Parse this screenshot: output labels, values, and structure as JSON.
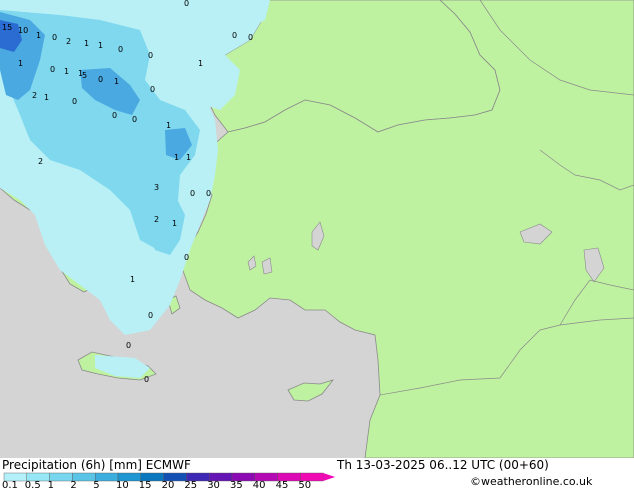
{
  "title": "Precipitation (6h) [mm] ECMWF",
  "valid_time": "Th 13-03-2025 06..12 UTC (00+60)",
  "credit": "©weatheronline.co.uk",
  "colors": {
    "sea": "#d4d4d4",
    "land": "#bff2a0",
    "border": "#8a8a8a",
    "precip_light": "#b8f0f6",
    "precip_mid": "#7fd8ee",
    "precip_heavy": "#4aa9e0",
    "precip_max": "#2a6cd2"
  },
  "legend": {
    "ticks": [
      "0.1",
      "0.5",
      "1",
      "2",
      "5",
      "10",
      "15",
      "20",
      "25",
      "30",
      "35",
      "40",
      "45",
      "50"
    ],
    "colors": [
      "#b4f0fa",
      "#96e6f5",
      "#78d7ee",
      "#5ac4e6",
      "#3caede",
      "#1e96d2",
      "#0a78be",
      "#1450b4",
      "#3c28b4",
      "#6414b4",
      "#8c0ab4",
      "#b40ab4",
      "#dc0ab4",
      "#f00ab4"
    ]
  },
  "map_values": [
    {
      "v": "15"
    },
    {
      "v": "10"
    },
    {
      "v": "1"
    },
    {
      "v": "0"
    },
    {
      "v": "2"
    },
    {
      "v": "1"
    },
    {
      "v": "1"
    },
    {
      "v": "0"
    },
    {
      "v": "0"
    },
    {
      "v": "5"
    },
    {
      "v": "0"
    },
    {
      "v": "1"
    },
    {
      "v": "2"
    },
    {
      "v": "1"
    },
    {
      "v": "1"
    },
    {
      "v": "0"
    },
    {
      "v": "1"
    },
    {
      "v": "1"
    },
    {
      "v": "0"
    },
    {
      "v": "0"
    },
    {
      "v": "1"
    },
    {
      "v": "0"
    },
    {
      "v": "0"
    },
    {
      "v": "1"
    },
    {
      "v": "1"
    },
    {
      "v": "2"
    },
    {
      "v": "3"
    },
    {
      "v": "2"
    },
    {
      "v": "1"
    },
    {
      "v": "0"
    },
    {
      "v": "0"
    },
    {
      "v": "0"
    },
    {
      "v": "1"
    },
    {
      "v": "0"
    },
    {
      "v": "0"
    },
    {
      "v": "0"
    },
    {
      "v": "0"
    },
    {
      "v": "0"
    },
    {
      "v": "0"
    },
    {
      "v": "1"
    }
  ]
}
